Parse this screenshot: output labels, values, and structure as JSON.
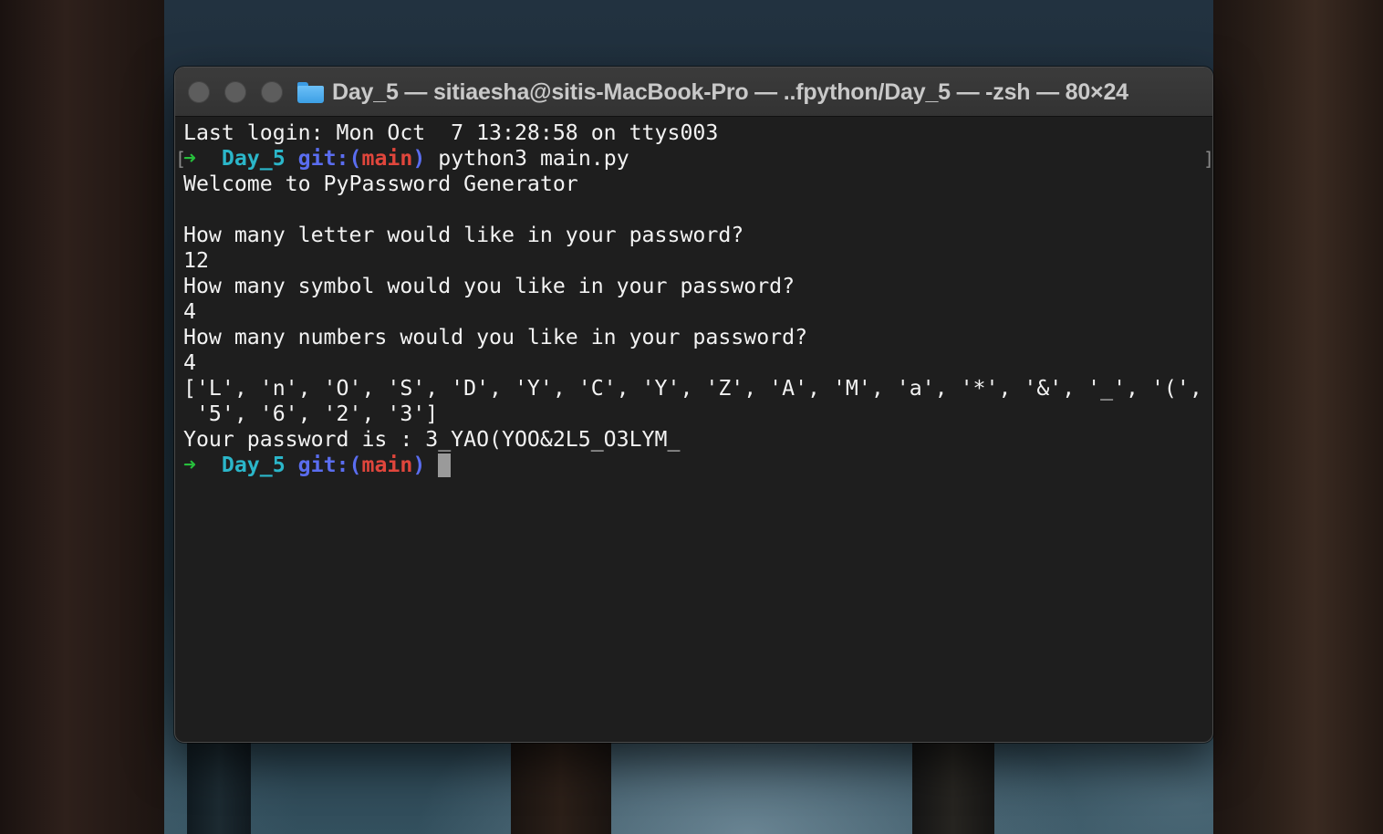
{
  "window": {
    "title": "Day_5 — sitiaesha@sitis-MacBook-Pro — ..fpython/Day_5 — -zsh — 80×24",
    "folder_icon": "folder-icon",
    "traffic_lights": [
      "close",
      "minimize",
      "zoom"
    ]
  },
  "terminal": {
    "last_login": "Last login: Mon Oct  7 13:28:58 on ttys003",
    "prompt": {
      "arrow": "➜",
      "dir": "Day_5",
      "git_label": "git:(",
      "branch": "main",
      "git_close": ")"
    },
    "command": "python3 main.py",
    "output": [
      "Welcome to PyPassword Generator",
      "",
      "How many letter would like in your password?",
      "12",
      "How many symbol would you like in your password?",
      "4",
      "How many numbers would you like in your password?",
      "4",
      "['L', 'n', 'O', 'S', 'D', 'Y', 'C', 'Y', 'Z', 'A', 'M', 'a', '*', '&', '_', '(',",
      " '5', '6', '2', '3']",
      "Your password is : 3_YAO(YOO&2L5_O3LYM_"
    ],
    "left_mark": "[",
    "right_mark": "]"
  },
  "colors": {
    "arrow": "#27c03c",
    "dir": "#2bb6c9",
    "git": "#5a6df0",
    "branch": "#e0463c",
    "background": "#1e1e1e",
    "text": "#f2f2f2"
  }
}
